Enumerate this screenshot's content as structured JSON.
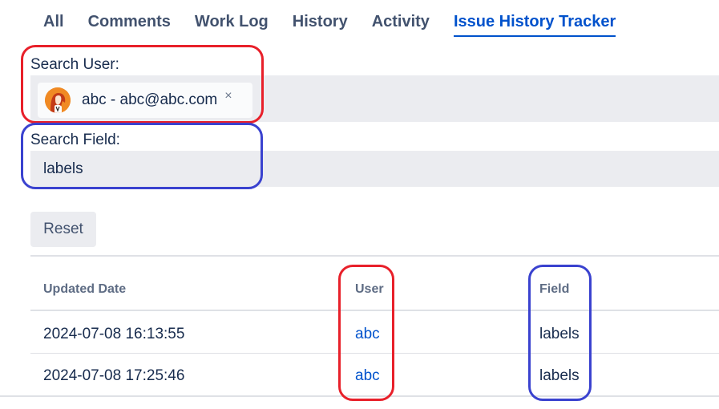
{
  "tabs": [
    "All",
    "Comments",
    "Work Log",
    "History",
    "Activity",
    "Issue History Tracker"
  ],
  "search_user": {
    "label": "Search User:",
    "selected": "abc - abc@abc.com",
    "remove_glyph": "×"
  },
  "search_field": {
    "label": "Search Field:",
    "value": "labels"
  },
  "reset_label": "Reset",
  "table": {
    "headers": {
      "date": "Updated Date",
      "user": "User",
      "field": "Field"
    },
    "rows": [
      {
        "date": "2024-07-08 16:13:55",
        "user": "abc",
        "field": "labels"
      },
      {
        "date": "2024-07-08 17:25:46",
        "user": "abc",
        "field": "labels"
      }
    ]
  },
  "colors": {
    "link": "#0052cc",
    "annotation_red": "#e8202a",
    "annotation_blue": "#3a42cf",
    "field_bg": "#ebecf0"
  }
}
